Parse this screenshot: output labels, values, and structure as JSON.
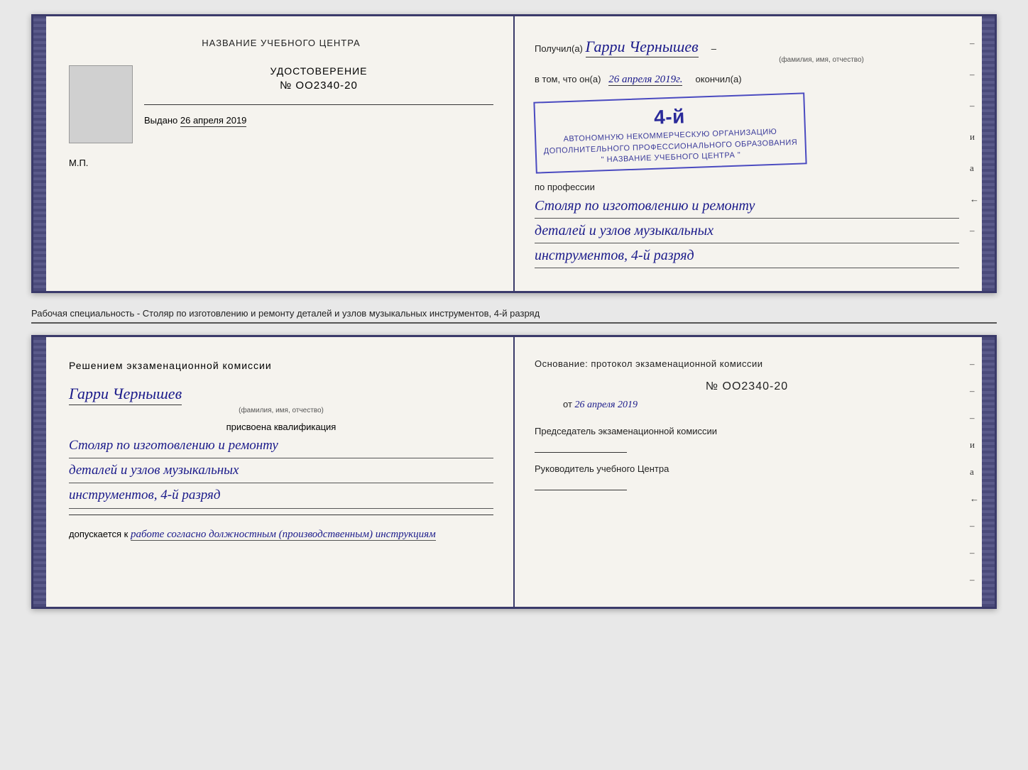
{
  "top_document": {
    "left": {
      "header": "НАЗВАНИЕ УЧЕБНОГО ЦЕНТРА",
      "cert_title": "УДОСТОВЕРЕНИЕ",
      "cert_number": "№ OO2340-20",
      "issued_label": "Выдано",
      "issued_date": "26 апреля 2019",
      "mp_label": "М.П."
    },
    "right": {
      "recipient_label": "Получил(а)",
      "recipient_name": "Гарри Чернышев",
      "fio_label": "(фамилия, имя, отчество)",
      "vtom_label": "в том, что он(а)",
      "date_value": "26 апреля 2019г.",
      "okonchil_label": "окончил(а)",
      "stamp_line1": "4-й",
      "stamp_org1": "АВТОНОМНУЮ НЕКОММЕРЧЕСКУЮ ОРГАНИЗАЦИЮ",
      "stamp_org2": "ДОПОЛНИТЕЛЬНОГО ПРОФЕССИОНАЛЬНОГО ОБРАЗОВАНИЯ",
      "stamp_org3": "\" НАЗВАНИЕ УЧЕБНОГО ЦЕНТРА \"",
      "profession_label": "по профессии",
      "profession_line1": "Столяр по изготовлению и ремонту",
      "profession_line2": "деталей и узлов музыкальных",
      "profession_line3": "инструментов, 4-й разряд",
      "dashes": [
        "-",
        "-",
        "-",
        "и",
        "а",
        "←",
        "-"
      ]
    }
  },
  "separator": {
    "text": "Рабочая специальность - Столяр по изготовлению и ремонту деталей и узлов музыкальных инструментов, 4-й разряд"
  },
  "bottom_document": {
    "left": {
      "resolution_title": "Решением  экзаменационной  комиссии",
      "person_name": "Гарри Чернышев",
      "fio_label": "(фамилия, имя, отчество)",
      "qualification_label": "присвоена квалификация",
      "qualification_line1": "Столяр по изготовлению и ремонту",
      "qualification_line2": "деталей и узлов музыкальных",
      "qualification_line3": "инструментов, 4-й разряд",
      "dopusk_label": "допускается к",
      "dopusk_value": "работе согласно должностным (производственным) инструкциям"
    },
    "right": {
      "osnование_title": "Основание: протокол экзаменационной  комиссии",
      "protocol_number": "№  OO2340-20",
      "protocol_date_label": "от",
      "protocol_date": "26 апреля 2019",
      "chairman_title": "Председатель экзаменационной комиссии",
      "rukovoditel_title": "Руководитель учебного Центра",
      "dashes": [
        "-",
        "-",
        "-",
        "и",
        "а",
        "←",
        "-",
        "-",
        "-"
      ]
    }
  }
}
